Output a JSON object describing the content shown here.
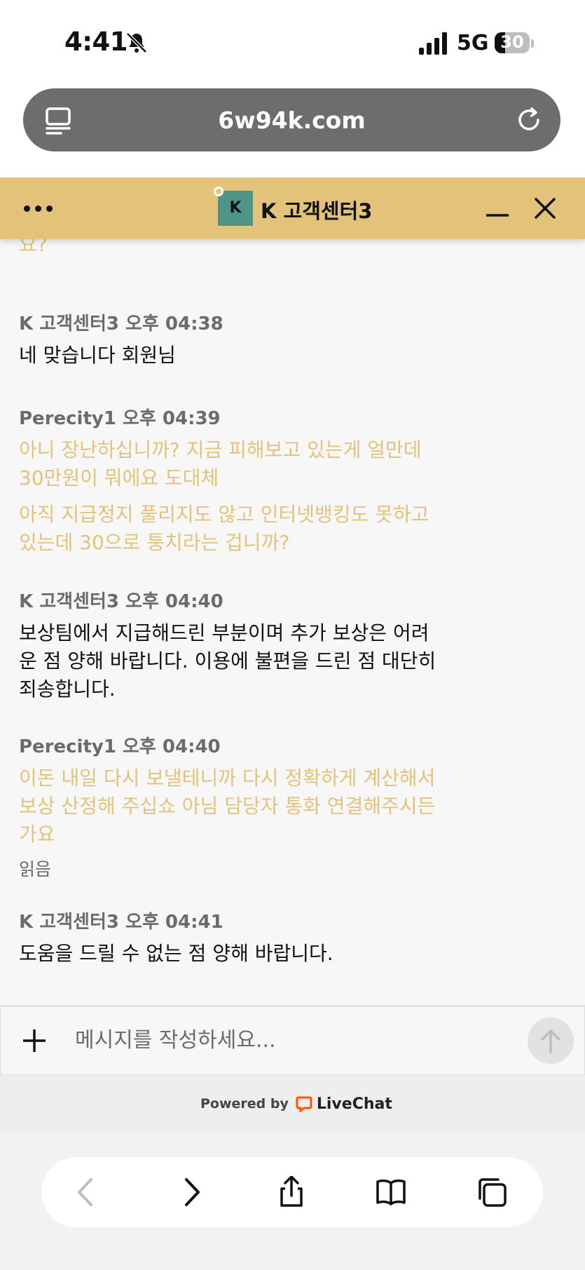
{
  "status_bar": {
    "time": "4:41",
    "network": "5G",
    "battery_level": "30",
    "battery_fraction": 0.3
  },
  "browser": {
    "url": "6w94k.com"
  },
  "chat": {
    "agent_initial": "K",
    "agent_name": "K 고객센터3",
    "messages": [
      {
        "sender": "",
        "text": "요?",
        "mine": true
      },
      {
        "sender": "K 고객센터3 오후 04:38",
        "text": "네 맞습니다 회원님",
        "mine": false
      },
      {
        "sender": "Perecity1 오후 04:39",
        "texts": [
          "아니 장난하십니까? 지금 피해보고 있는게 얼만데 30만원이 뭐에요 도대체",
          "아직 지급정지 풀리지도 않고 인터넷뱅킹도 못하고 있는데 30으로 퉁치라는 겁니까?"
        ],
        "mine": true
      },
      {
        "sender": "K 고객센터3 오후 04:40",
        "text": "보상팀에서 지급해드린 부분이며 추가 보상은 어려운 점 양해 바랍니다. 이용에 불편을 드린 점 대단히 죄송합니다.",
        "mine": false
      },
      {
        "sender": "Perecity1 오후 04:40",
        "text": "이돈 내일 다시 보낼테니까 다시 정확하게 계산해서 보상 산정해 주십쇼 아님 담당자 통화 연결해주시든 가요",
        "mine": true,
        "read_label": "읽음"
      },
      {
        "sender": "K 고객센터3 오후 04:41",
        "text": "도움을 드릴 수 없는 점 양해 바랍니다.",
        "mine": false
      }
    ],
    "input_placeholder": "메시지를 작성하세요...",
    "powered_by": "Powered by",
    "livechat": "LiveChat"
  },
  "colors": {
    "accent": "#e3c37a",
    "avatar": "#4f9488"
  }
}
